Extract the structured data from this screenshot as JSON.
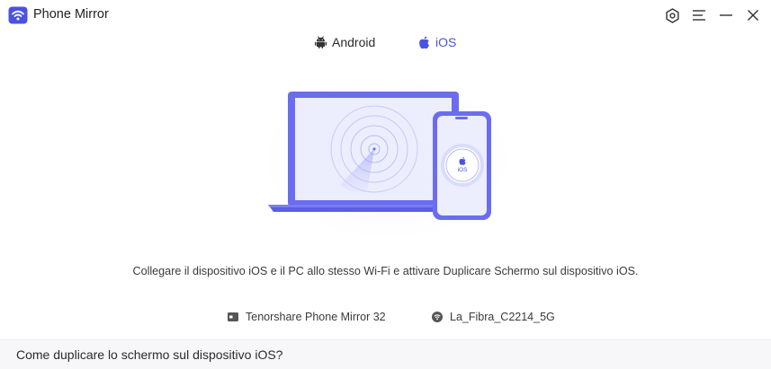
{
  "app": {
    "title": "Phone Mirror"
  },
  "window_controls": [
    "gear-icon",
    "menu-icon",
    "minimize-icon",
    "close-icon"
  ],
  "tabs": [
    {
      "label": "Android",
      "icon": "android-icon",
      "active": false
    },
    {
      "label": "iOS",
      "icon": "apple-icon",
      "active": true
    }
  ],
  "illustration": {
    "phone_badge": "iOS"
  },
  "instruction": "Collegare il dispositivo iOS e il PC allo stesso Wi-Fi e attivare Duplicare Schermo sul dispositivo iOS.",
  "connection": {
    "pc_name": "Tenorshare Phone Mirror 32",
    "wifi_name": "La_Fibra_C2214_5G"
  },
  "footer": {
    "help_link": "Come duplicare lo schermo sul dispositivo iOS?"
  },
  "colors": {
    "accent": "#4a52e0",
    "device_purple": "#6b6cf0",
    "device_light": "#eceefe"
  }
}
